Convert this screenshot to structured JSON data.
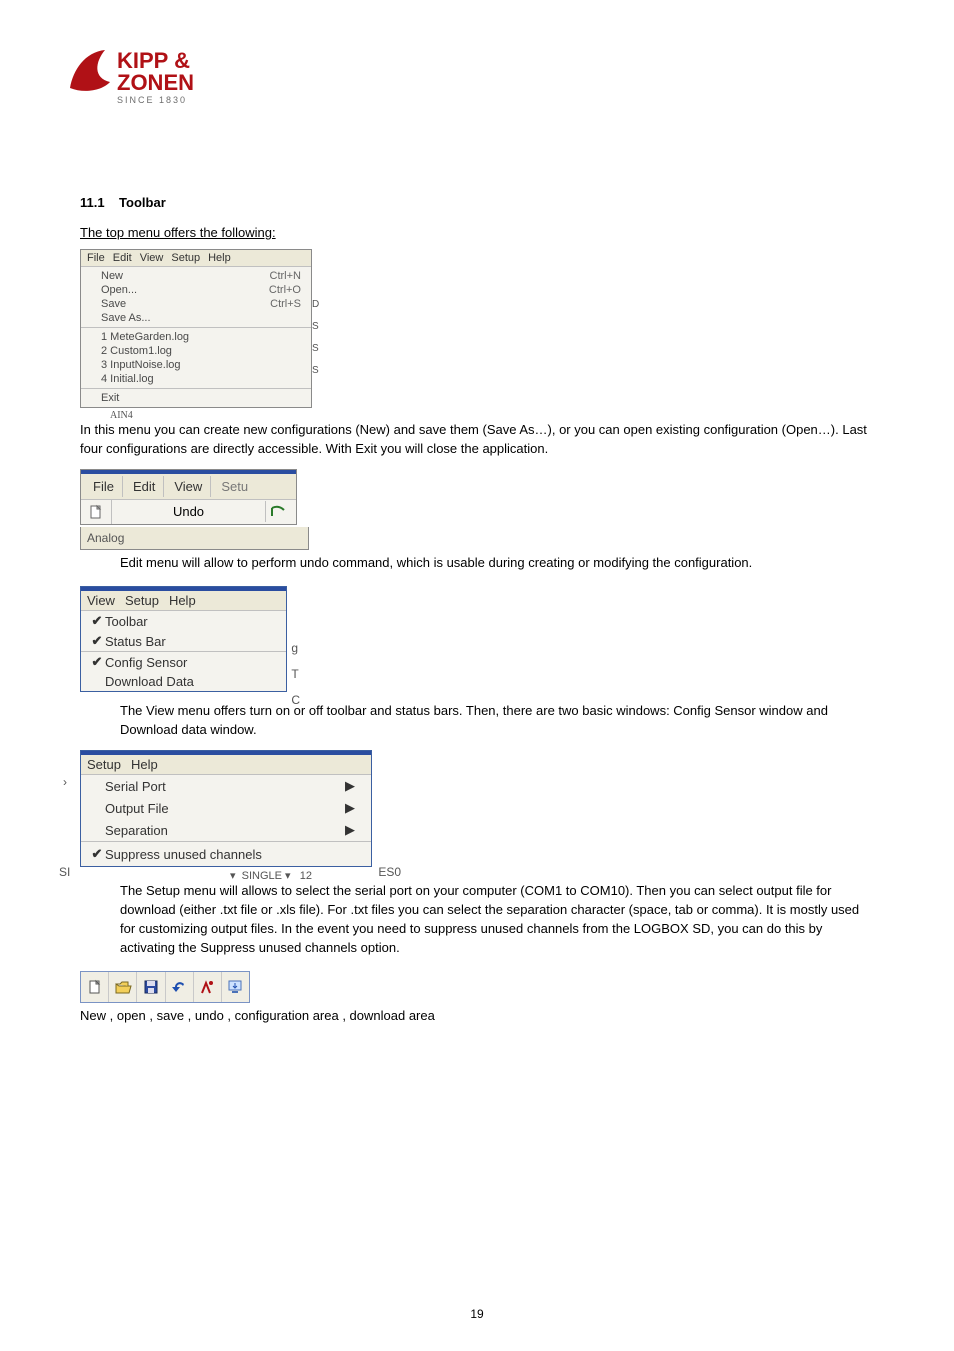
{
  "section_number": "11.1",
  "section_title": "Toolbar",
  "intro_line": "The top menu offers the following:",
  "file_menu": {
    "bar": [
      "File",
      "Edit",
      "View",
      "Setup",
      "Help"
    ],
    "group1": [
      {
        "label": "New",
        "accel": "Ctrl+N"
      },
      {
        "label": "Open...",
        "accel": "Ctrl+O"
      },
      {
        "label": "Save",
        "accel": "Ctrl+S"
      },
      {
        "label": "Save As...",
        "accel": ""
      }
    ],
    "group2": [
      {
        "label": "1 MeteGarden.log"
      },
      {
        "label": "2 Custom1.log"
      },
      {
        "label": "3 InputNoise.log"
      },
      {
        "label": "4 Initial.log"
      }
    ],
    "group3": [
      {
        "label": "Exit"
      }
    ],
    "footer": "AIN4"
  },
  "para_file": "In this menu you can create new configurations (New) and save them (Save As…), or you can open existing configuration (Open…). Last four configurations are directly accessible. With Exit you will close the application.",
  "edit_menu": {
    "bar": [
      "File",
      "Edit",
      "View",
      "Setu"
    ],
    "undo": "Undo",
    "analog": "Analog"
  },
  "para_edit": "Edit menu will allow to perform undo command, which is usable during creating or modifying the configuration.",
  "view_menu": {
    "bar": [
      "View",
      "Setup",
      "Help"
    ],
    "g1": [
      "Toolbar",
      "Status Bar"
    ],
    "g2": [
      "Config Sensor",
      "Download Data"
    ]
  },
  "para_view": "The View menu offers turn on or off toolbar and status bars. Then, there are two basic windows: Config Sensor window and Download data window.",
  "setup_menu": {
    "bar": [
      "Setup",
      "Help"
    ],
    "items": [
      "Serial Port",
      "Output File",
      "Separation"
    ],
    "suppress": "Suppress unused channels",
    "side_si": "SI",
    "side_es": "ES0",
    "single": "SINGLE",
    "single_num": "12"
  },
  "para_setup": "The Setup menu will allows to select the serial port on your computer (COM1 to COM10). Then you can select output file for download (either .txt file or .xls file). For .txt files you can select the separation character (space, tab or comma). It is mostly used for customizing output files. In the event you need to suppress unused channels from the LOGBOX SD, you can do this by activating the Suppress unused channels option.",
  "toolbar_caption": "New , open , save , undo , configuration area , download area",
  "page_number": "19"
}
